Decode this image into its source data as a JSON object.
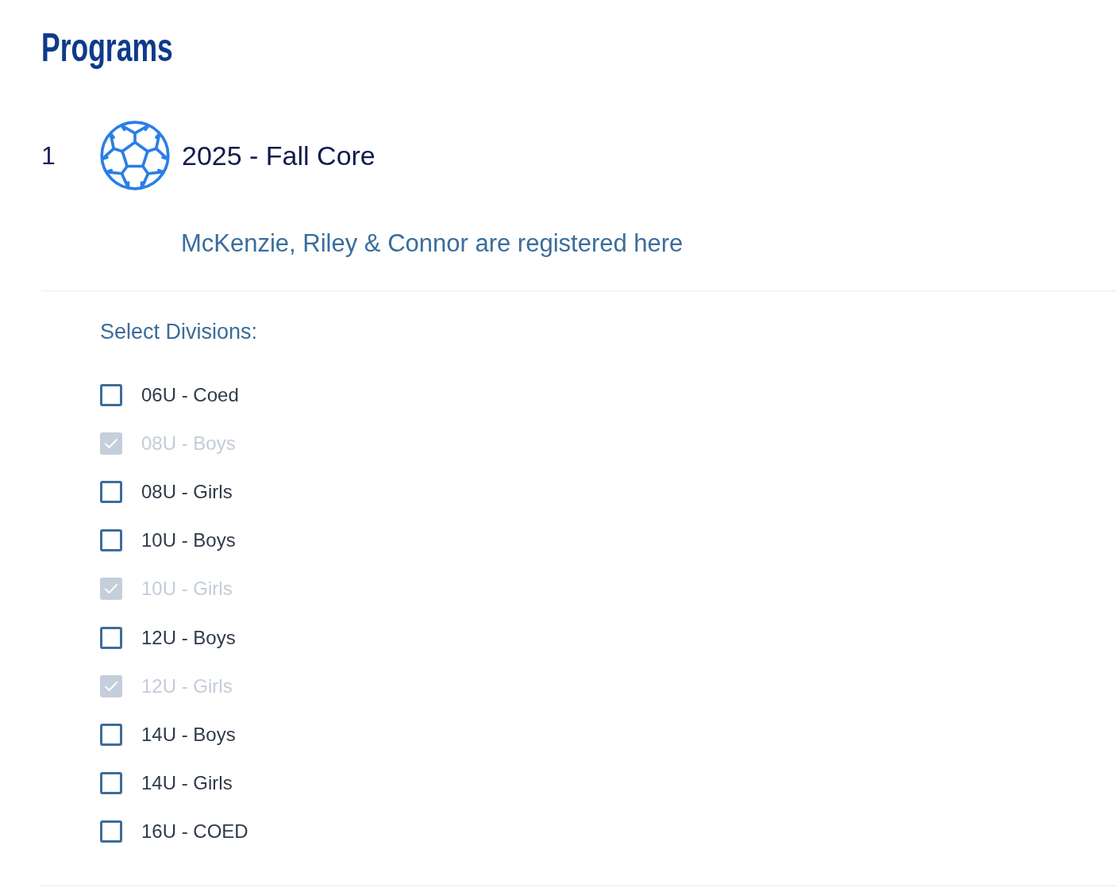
{
  "page": {
    "title": "Programs"
  },
  "programs": [
    {
      "number": "1",
      "name": "2025 - Fall Core",
      "registered_note": "McKenzie, Riley & Connor are registered here",
      "divisions_label": "Select Divisions:",
      "divisions": [
        {
          "label": "06U - Coed",
          "checked": false,
          "disabled": false
        },
        {
          "label": "08U - Boys",
          "checked": true,
          "disabled": true
        },
        {
          "label": "08U - Girls",
          "checked": false,
          "disabled": false
        },
        {
          "label": "10U - Boys",
          "checked": false,
          "disabled": false
        },
        {
          "label": "10U - Girls",
          "checked": true,
          "disabled": true
        },
        {
          "label": "12U - Boys",
          "checked": false,
          "disabled": false
        },
        {
          "label": "12U - Girls",
          "checked": true,
          "disabled": true
        },
        {
          "label": "14U - Boys",
          "checked": false,
          "disabled": false
        },
        {
          "label": "14U - Girls",
          "checked": false,
          "disabled": false
        },
        {
          "label": "16U - COED",
          "checked": false,
          "disabled": false
        }
      ]
    }
  ]
}
